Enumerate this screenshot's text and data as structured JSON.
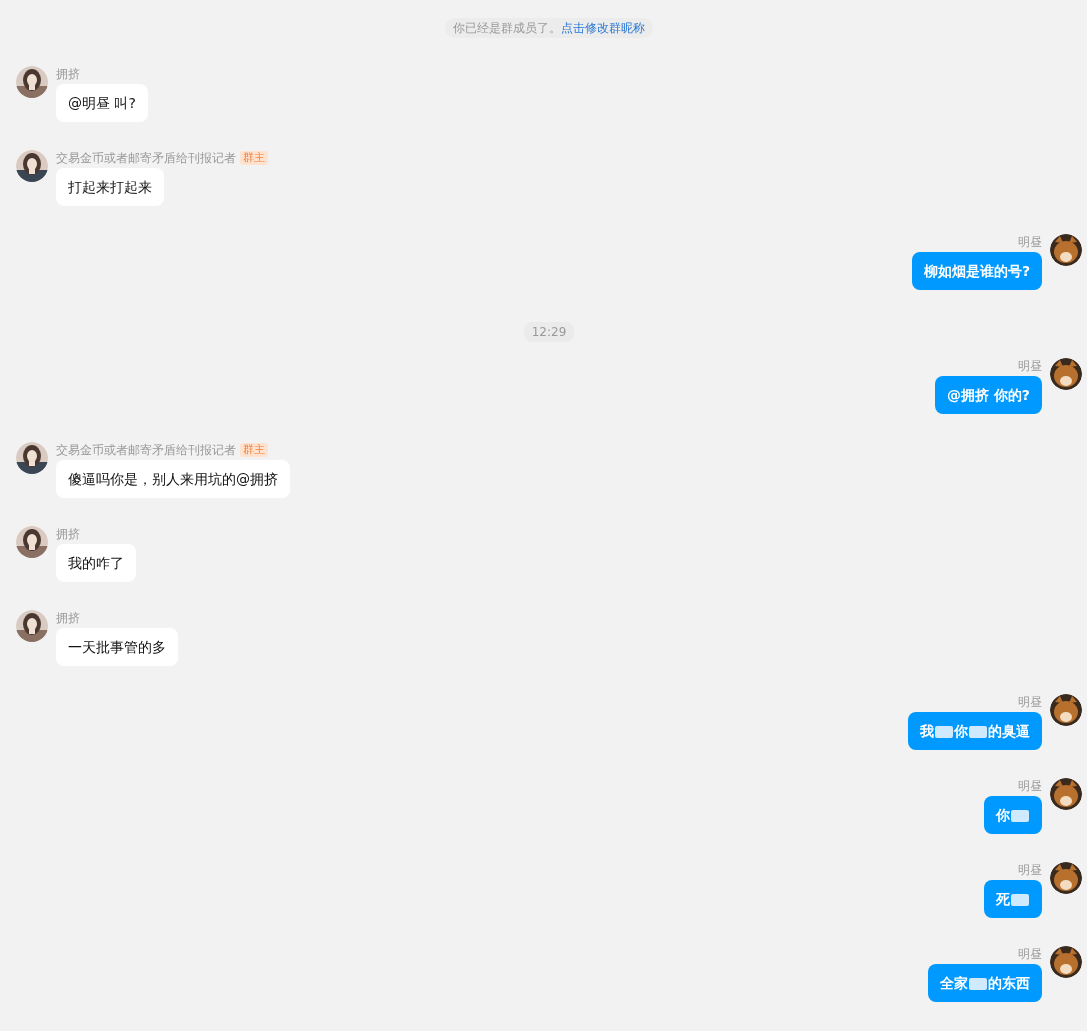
{
  "system_notice": {
    "text": "你已经是群成员了。",
    "link": "点击修改群昵称"
  },
  "messages": [
    {
      "kind": "message",
      "outgoing": false,
      "sender": "拥挤",
      "color": "#8a6f63",
      "segments": [
        {
          "kind": "text",
          "text": "@明昼 叫?"
        }
      ]
    },
    {
      "kind": "message",
      "outgoing": false,
      "sender": "交易金币或者邮寄矛盾给刊报记者",
      "badge": "群主",
      "color": "#3b4654",
      "segments": [
        {
          "kind": "text",
          "text": "打起来打起来"
        }
      ]
    },
    {
      "kind": "message",
      "outgoing": true,
      "sender": "明昼",
      "color": "#b8702e",
      "segments": [
        {
          "kind": "text",
          "text": "柳如烟是谁的号?"
        }
      ]
    },
    {
      "kind": "time",
      "text": "12:29"
    },
    {
      "kind": "message",
      "outgoing": true,
      "sender": "明昼",
      "color": "#b8702e",
      "segments": [
        {
          "kind": "text",
          "text": "@拥挤 你的?"
        }
      ]
    },
    {
      "kind": "message",
      "outgoing": false,
      "sender": "交易金币或者邮寄矛盾给刊报记者",
      "badge": "群主",
      "color": "#3b4654",
      "segments": [
        {
          "kind": "text",
          "text": "傻逼吗你是，别人来用坑的@拥挤"
        }
      ]
    },
    {
      "kind": "message",
      "outgoing": false,
      "sender": "拥挤",
      "color": "#8a6f63",
      "segments": [
        {
          "kind": "text",
          "text": "我的咋了"
        }
      ]
    },
    {
      "kind": "message",
      "outgoing": false,
      "sender": "拥挤",
      "color": "#8a6f63",
      "segments": [
        {
          "kind": "text",
          "text": "一天批事管的多"
        }
      ]
    },
    {
      "kind": "message",
      "outgoing": true,
      "sender": "明昼",
      "color": "#b8702e",
      "segments": [
        {
          "kind": "text",
          "text": "我"
        },
        {
          "kind": "blur"
        },
        {
          "kind": "text",
          "text": "你"
        },
        {
          "kind": "blur"
        },
        {
          "kind": "text",
          "text": "的臭逼"
        }
      ]
    },
    {
      "kind": "message",
      "outgoing": true,
      "sender": "明昼",
      "color": "#b8702e",
      "segments": [
        {
          "kind": "text",
          "text": "你"
        },
        {
          "kind": "blur"
        }
      ]
    },
    {
      "kind": "message",
      "outgoing": true,
      "sender": "明昼",
      "color": "#b8702e",
      "segments": [
        {
          "kind": "text",
          "text": "死"
        },
        {
          "kind": "blur"
        }
      ]
    },
    {
      "kind": "message",
      "outgoing": true,
      "sender": "明昼",
      "color": "#b8702e",
      "segments": [
        {
          "kind": "text",
          "text": "全家"
        },
        {
          "kind": "blur"
        },
        {
          "kind": "text",
          "text": "的东西"
        }
      ]
    }
  ]
}
